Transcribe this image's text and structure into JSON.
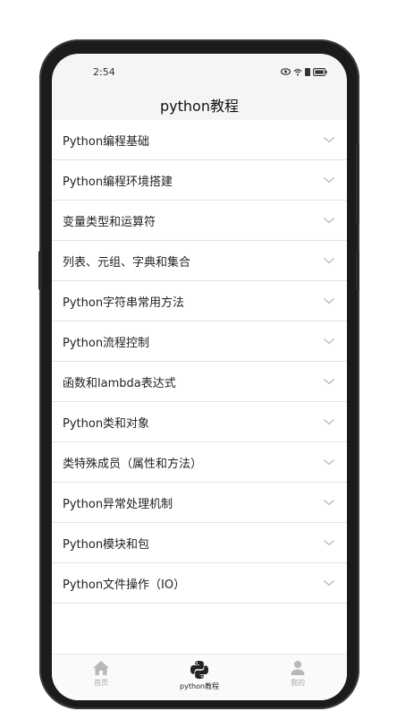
{
  "status": {
    "time": "2:54"
  },
  "header": {
    "title": "python教程"
  },
  "chapters": [
    "Python编程基础",
    "Python编程环境搭建",
    "变量类型和运算符",
    "列表、元组、字典和集合",
    "Python字符串常用方法",
    "Python流程控制",
    "函数和lambda表达式",
    "Python类和对象",
    "类特殊成员（属性和方法）",
    "Python异常处理机制",
    "Python模块和包",
    "Python文件操作（IO）"
  ],
  "tabs": [
    {
      "label": "首页",
      "icon": "home-icon",
      "active": false
    },
    {
      "label": "python教程",
      "icon": "python-icon",
      "active": true
    },
    {
      "label": "我的",
      "icon": "user-icon",
      "active": false
    }
  ]
}
